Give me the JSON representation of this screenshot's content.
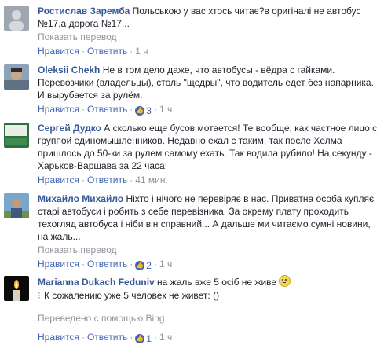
{
  "comments": [
    {
      "author": "Ростислав Заремба",
      "text": "Польською у вас хтось читає?в оригіналі не автобус №17,а дорога №17...",
      "translate": "Показать перевод",
      "like": "Нравится",
      "reply": "Ответить",
      "time": "1 ч"
    },
    {
      "author": "Oleksii Chekh",
      "text": "Не в том дело даже, что автобусы - вёдра с гайками. Перевозчики (владельцы), столь \"щедры\", что водитель едет без напарника. И вырубается за рулём.",
      "like": "Нравится",
      "reply": "Ответить",
      "likes": "3",
      "time": "1 ч"
    },
    {
      "author": "Сергей Дудко",
      "text": "А сколько еще бусов мотается! Те вообще, как частное лицо с группой единомышленников. Недавно ехал с таким, так после Хелма пришлось до 50-ки за рулем самому ехать. Так водила рубило! На секунду - Харьков-Варшава за 22 часа!",
      "like": "Нравится",
      "reply": "Ответить",
      "time": "41 мин."
    },
    {
      "author": "Михайло Михайло",
      "text": "Ніхто і нічого не перевіряє в нас. Приватна особа купляє старі автобуси і робить з себе перевізника. За окрему плату проходить техогляд автобуса і ніби він справний... А дальше ми читаємо сумні новини, на жаль...",
      "translate": "Показать перевод",
      "like": "Нравится",
      "reply": "Ответить",
      "likes": "2",
      "time": "1 ч"
    },
    {
      "author": "Marianna Dukach Feduniv",
      "text": "на жаль вже 5 осіб не живе",
      "translated": "К сожалению уже 5 человек не живет: ()",
      "bing": "Переведено с помощью Bing",
      "like": "Нравится",
      "reply": "Ответить",
      "likes": "1",
      "time": "1 ч"
    }
  ],
  "colors": {
    "link": "#365899",
    "action": "#4267b2",
    "muted": "#90949c"
  }
}
